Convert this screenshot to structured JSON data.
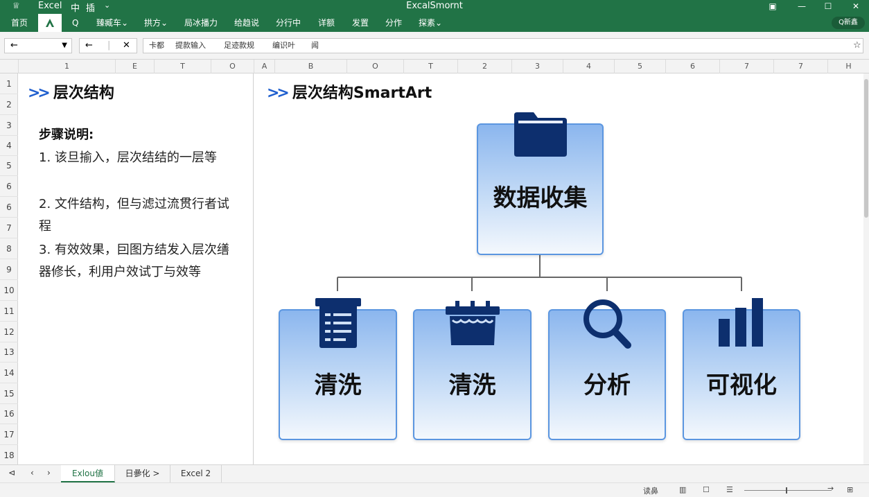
{
  "titlebar": {
    "app": "Excel",
    "menu_zh": "中",
    "menu_insert": "插",
    "dropdown": "⌄",
    "doc_title": "ExcalSmornt"
  },
  "ribbon": {
    "tabs": [
      "首页",
      "Q",
      "臻臧车⌄",
      "拱方⌄",
      "局冰播力",
      "给趋说",
      "分行中",
      "详额",
      "发置",
      "分作",
      "探素⌄"
    ],
    "search_pill": "Q新鑫"
  },
  "toolbar": {
    "namebox_value": "←",
    "back": "←",
    "close": "✕",
    "items": [
      "卡都",
      "提款输入",
      "足迹款规",
      "编识叶",
      "闻"
    ],
    "star": "☆"
  },
  "columns": [
    "1",
    "E",
    "T",
    "O",
    "A",
    "B",
    "O",
    "T",
    "2",
    "3",
    "4",
    "5",
    "6",
    "7",
    "7",
    "H"
  ],
  "rows": [
    "1",
    "2",
    "3",
    "4",
    "5",
    "6",
    "6",
    "7",
    "8",
    "9",
    "10",
    "11",
    "12",
    "13",
    "14",
    "15",
    "16",
    "17",
    "18"
  ],
  "left_panel": {
    "title": "层次结构",
    "steps_heading": "步骤说明:",
    "steps": [
      "1. 该旦揄入，层次结结的一层等",
      "2. 文件结构，但与滤过流贯行者试程",
      "3. 有效效果，囙图方结发入层次缮器修长，利用户效试丁与效等"
    ]
  },
  "smartart": {
    "title": "层次结构SmartArt",
    "root": {
      "label": "数据收集",
      "icon": "folder-icon"
    },
    "children": [
      {
        "label": "清洗",
        "icon": "list-document-icon"
      },
      {
        "label": "清洗",
        "icon": "water-tank-icon"
      },
      {
        "label": "分析",
        "icon": "magnifier-icon"
      },
      {
        "label": "可视化",
        "icon": "bar-chart-icon"
      }
    ],
    "colors": {
      "node_border": "#5b96e0",
      "icon": "#0d2f6e",
      "chevron": "#1f5fcf"
    }
  },
  "sheet_tabs": [
    "Exlou値",
    "日曑化 >",
    "Excel 2"
  ],
  "active_sheet": "Exlou値",
  "statusbar": {
    "label": "读鼻"
  },
  "theme": {
    "excel_green": "#217346"
  }
}
